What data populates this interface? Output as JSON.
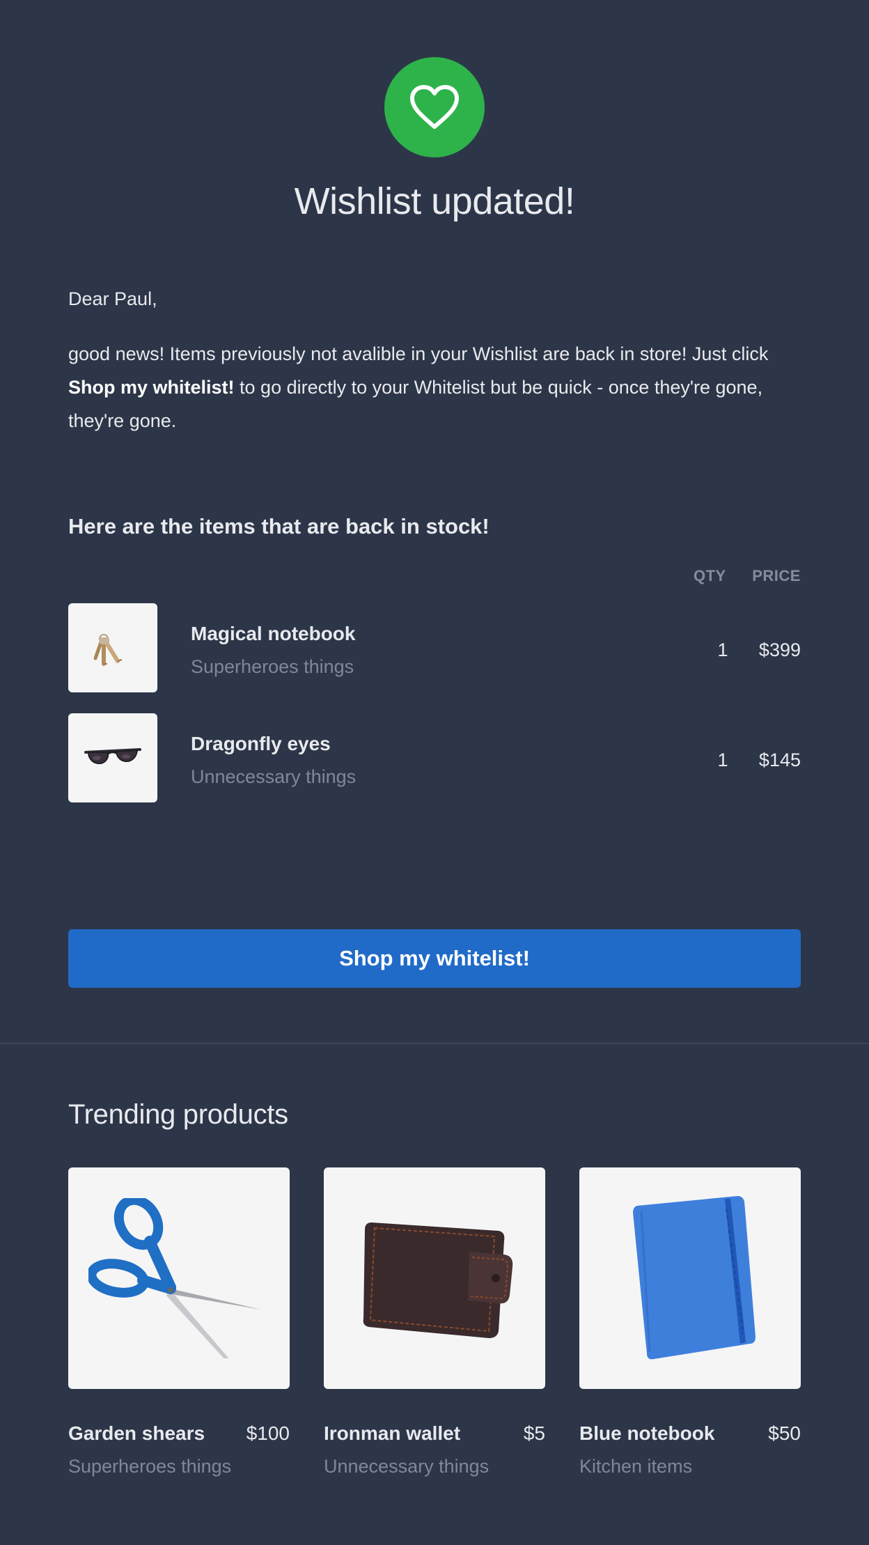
{
  "header": {
    "icon": "heart-icon",
    "icon_bg": "#2db34a",
    "title": "Wishlist updated!"
  },
  "message": {
    "greeting": "Dear Paul,",
    "intro_before": "good news! Items previously not avalible in your Wishlist are back in store! Just click ",
    "intro_bold": "Shop my whitelist!",
    "intro_after": " to go directly to your Whitelist but be quick - once they're gone, they're gone."
  },
  "stock": {
    "heading": "Here are the items that are back in stock!",
    "col_qty": "QTY",
    "col_price": "PRICE",
    "items": [
      {
        "name": "Magical notebook",
        "category": "Superheroes things",
        "qty": "1",
        "price": "$399",
        "image": "keys-image"
      },
      {
        "name": "Dragonfly eyes",
        "category": "Unnecessary things",
        "qty": "1",
        "price": "$145",
        "image": "sunglasses-image"
      }
    ]
  },
  "cta": {
    "label": "Shop my whitelist!",
    "color": "#216bc8"
  },
  "trending": {
    "title": "Trending products",
    "products": [
      {
        "name": "Garden shears",
        "price": "$100",
        "category": "Superheroes things",
        "image": "scissors-image"
      },
      {
        "name": "Ironman wallet",
        "price": "$5",
        "category": "Unnecessary things",
        "image": "wallet-image"
      },
      {
        "name": "Blue notebook",
        "price": "$50",
        "category": "Kitchen items",
        "image": "notebook-image"
      }
    ]
  },
  "colors": {
    "background": "#2d3648",
    "muted_text": "#7f8898"
  }
}
